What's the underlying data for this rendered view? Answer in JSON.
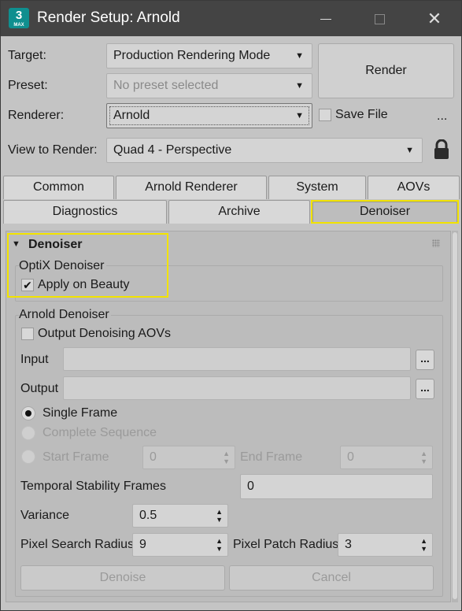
{
  "window": {
    "title": "Render Setup: Arnold",
    "app_icon_text": "3",
    "app_icon_sub": "MAX"
  },
  "top": {
    "target_label": "Target:",
    "target_value": "Production Rendering Mode",
    "preset_label": "Preset:",
    "preset_placeholder": "No preset selected",
    "renderer_label": "Renderer:",
    "renderer_value": "Arnold",
    "save_file_label": "Save File",
    "more_label": "...",
    "view_label": "View to Render:",
    "view_value": "Quad 4 - Perspective",
    "render_button": "Render"
  },
  "tabs": {
    "row1": [
      "Common",
      "Arnold Renderer",
      "System",
      "AOVs"
    ],
    "row2": [
      "Diagnostics",
      "Archive",
      "Denoiser"
    ],
    "active": "Denoiser"
  },
  "denoiser": {
    "rollout_title": "Denoiser",
    "optix": {
      "title": "OptiX Denoiser",
      "apply_on_beauty": "Apply on Beauty",
      "apply_checked": true
    },
    "arnold": {
      "title": "Arnold Denoiser",
      "output_aovs": "Output Denoising AOVs",
      "input_label": "Input",
      "output_label": "Output",
      "browse": "...",
      "single_frame": "Single Frame",
      "complete_sequence": "Complete Sequence",
      "start_frame": "Start Frame",
      "start_value": "0",
      "end_frame": "End Frame",
      "end_value": "0",
      "temporal_label": "Temporal Stability Frames",
      "temporal_value": "0",
      "variance_label": "Variance",
      "variance_value": "0.5",
      "search_radius_label": "Pixel Search Radius",
      "search_radius_value": "9",
      "patch_radius_label": "Pixel Patch Radius",
      "patch_radius_value": "3",
      "denoise_button": "Denoise",
      "cancel_button": "Cancel"
    }
  },
  "colors": {
    "highlight": "#f2e300",
    "titlebar": "#444444",
    "panel": "#bcbcbc"
  }
}
